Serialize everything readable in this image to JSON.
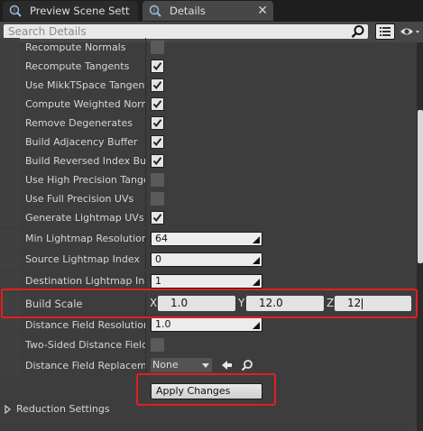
{
  "tabs": [
    {
      "label": "Preview Scene Sett",
      "active": false
    },
    {
      "label": "Details",
      "active": true
    }
  ],
  "search": {
    "placeholder": "Search Details"
  },
  "properties": [
    {
      "label": "Recompute Normals",
      "checked": false
    },
    {
      "label": "Recompute Tangents",
      "checked": true
    },
    {
      "label": "Use MikkTSpace Tangent",
      "checked": true
    },
    {
      "label": "Compute Weighted Normal",
      "checked": true
    },
    {
      "label": "Remove Degenerates",
      "checked": true
    },
    {
      "label": "Build Adjacency Buffer",
      "checked": true
    },
    {
      "label": "Build Reversed Index Buffe",
      "checked": true
    },
    {
      "label": "Use High Precision Tanger",
      "checked": false
    },
    {
      "label": "Use Full Precision UVs",
      "checked": false
    },
    {
      "label": "Generate Lightmap UVs",
      "checked": true
    }
  ],
  "min_lightmap": {
    "label": "Min Lightmap Resolution",
    "value": "64"
  },
  "source_lightmap": {
    "label": "Source Lightmap Index",
    "value": "0"
  },
  "dest_lightmap": {
    "label": "Destination Lightmap Inde",
    "value": "1"
  },
  "build_scale": {
    "label": "Build Scale",
    "x_label": "X",
    "x_value": "1.0",
    "y_label": "Y",
    "y_value": "12.0",
    "z_label": "Z",
    "z_value": "12"
  },
  "distance_field_res": {
    "label": "Distance Field Resolution S",
    "value": "1.0"
  },
  "two_sided_df": {
    "label": "Two-Sided Distance Field G",
    "checked": false
  },
  "df_replacement": {
    "label": "Distance Field Replacemen",
    "value": "None"
  },
  "apply_button": {
    "label": "Apply Changes"
  },
  "reduction_settings": {
    "label": "Reduction Settings"
  },
  "colors": {
    "highlight": "#e21f1f",
    "panel": "#3d3d3d",
    "tab_active": "#474747"
  }
}
